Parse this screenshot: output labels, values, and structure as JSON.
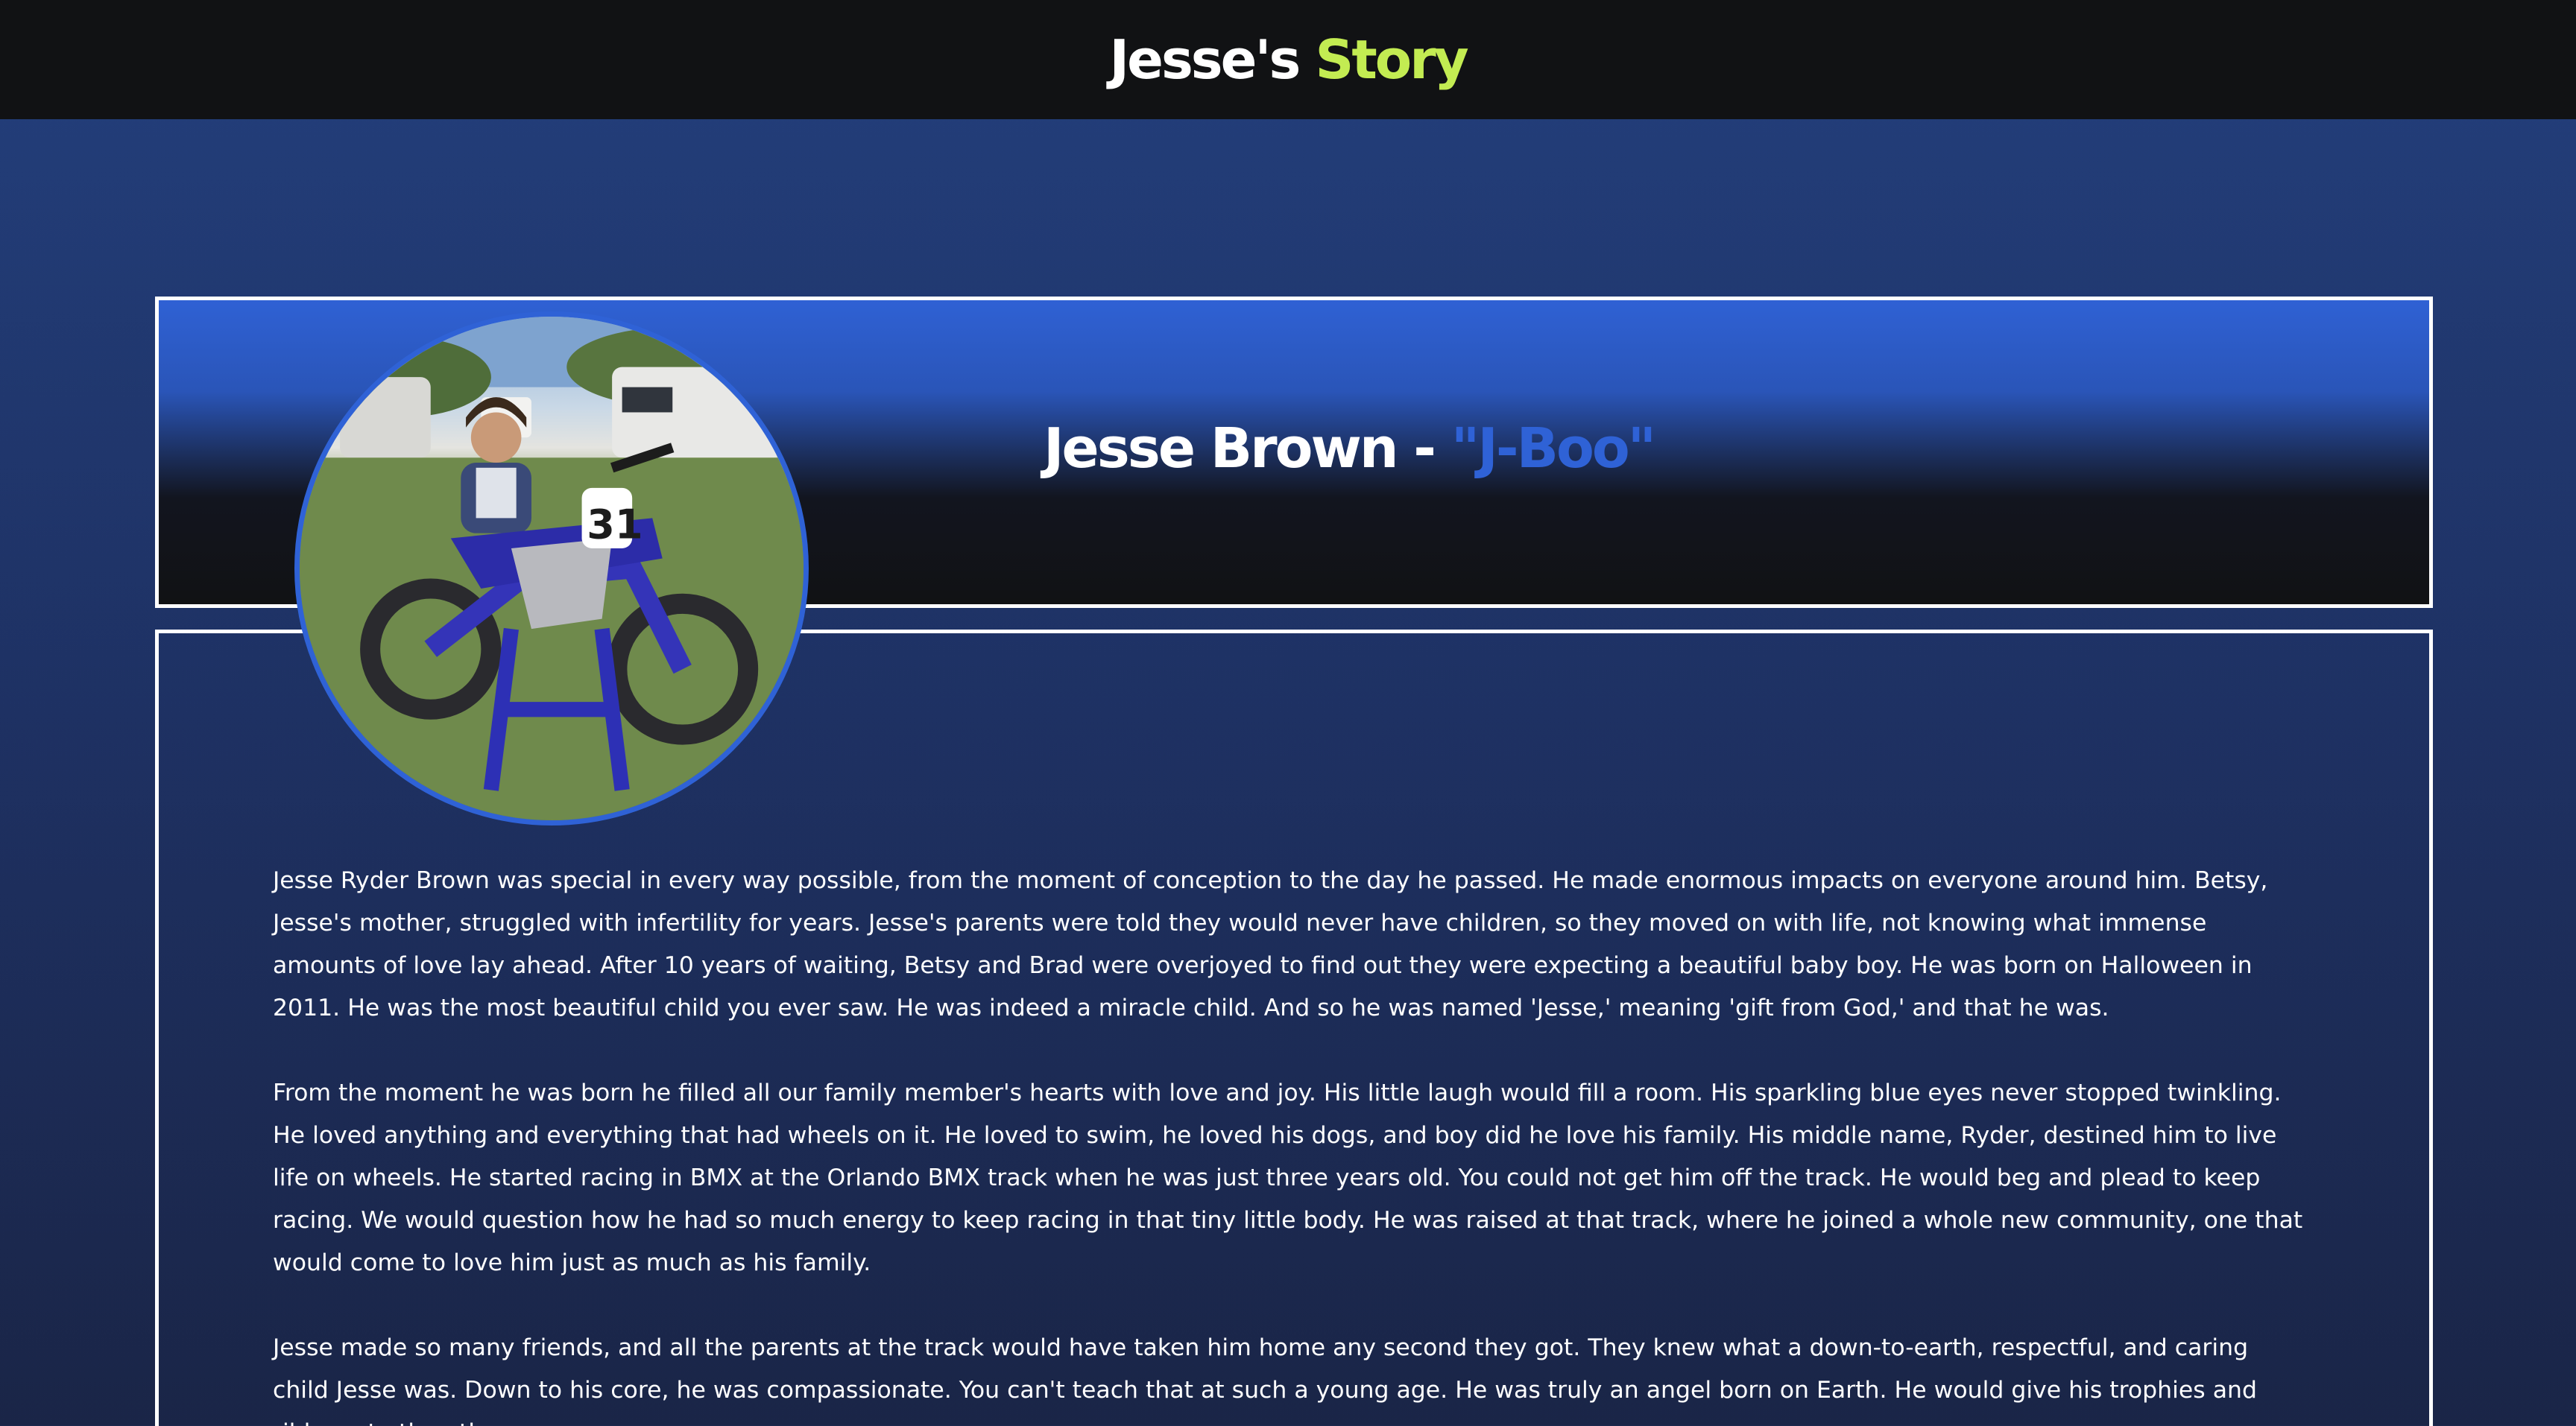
{
  "header": {
    "title_main": "Jesse's",
    "title_accent": "Story"
  },
  "profile": {
    "name": "Jesse Brown -",
    "nickname": "\"J-Boo\"",
    "photo_icon": "portrait-photo"
  },
  "story": {
    "paragraphs": [
      "Jesse Ryder Brown was special in every way possible, from the moment of conception to the day he passed. He made enormous impacts on everyone around him. Betsy, Jesse's mother, struggled with infertility for years. Jesse's parents were told they would never have children, so they moved on with life, not knowing what immense amounts of love lay ahead. After 10 years of waiting, Betsy and Brad were overjoyed to find out they were expecting a beautiful baby boy. He was born on Halloween in 2011. He was the most beautiful child you ever saw. He was indeed a miracle child. And so he was named 'Jesse,' meaning 'gift from God,' and that he was.",
      "From the moment he was born he filled all our family member's hearts with love and joy. His little laugh would fill a room. His sparkling blue eyes never stopped twinkling. He loved anything and everything that had wheels on it. He loved to swim, he loved his dogs, and boy did he love his family. His middle name, Ryder, destined him to live life on wheels. He started racing in BMX at the Orlando BMX track when he was just three years old. You could not get him off the track. He would beg and plead to keep racing. We would question how he had so much energy to keep racing in that tiny little body. He was raised at that track, where he joined a whole new community, one that would come to love him just as much as his family.",
      "Jesse made so many friends, and all the parents at the track would have taken him home any second they got. They knew what a down-to-earth, respectful, and caring child Jesse was. Down to his core, he was compassionate. You can't teach that at such a young age. He was truly an angel born on Earth. He would give his trophies and ribbons to the other"
    ]
  },
  "colors": {
    "topbar": "#111214",
    "accent_green": "#c3ec52",
    "accent_blue": "#2f62d6",
    "background": "#1e3163"
  }
}
